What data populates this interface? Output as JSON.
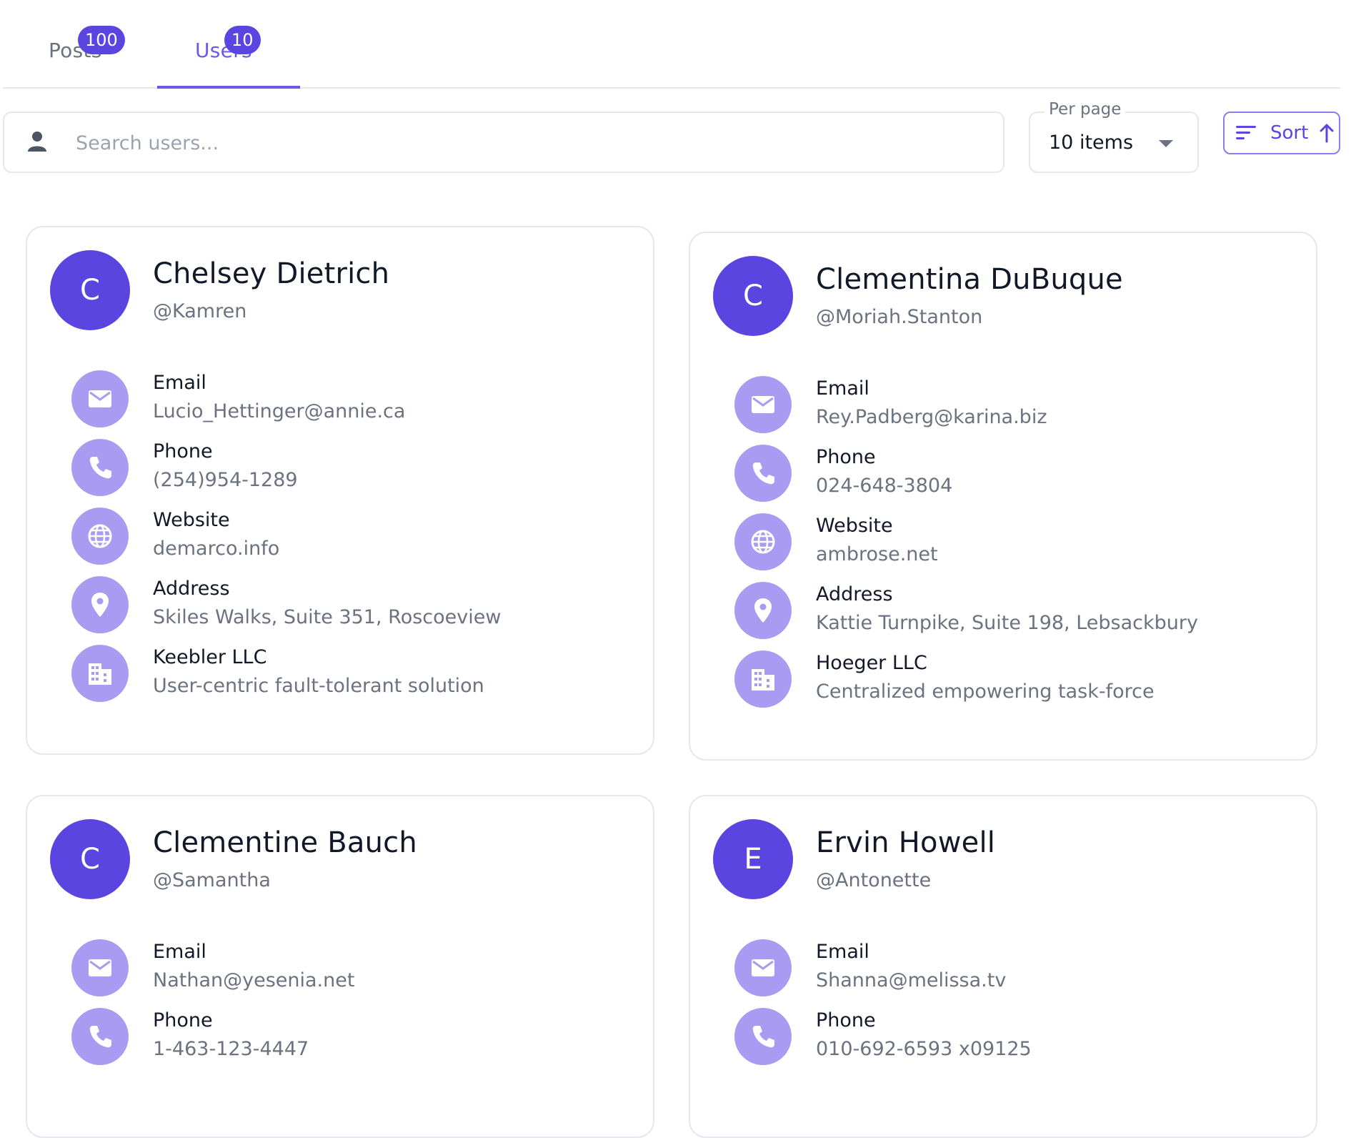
{
  "tabs": [
    {
      "label": "Posts",
      "count": "100"
    },
    {
      "label": "Users",
      "count": "10"
    }
  ],
  "search": {
    "placeholder": "Search users..."
  },
  "per_page": {
    "label": "Per page",
    "value": "10 items"
  },
  "sort": {
    "label": "Sort"
  },
  "colors": {
    "accent": "#6f55e8",
    "avatar": "#5b45e0",
    "icon_bg": "#a99bf2"
  },
  "users": [
    {
      "initial": "C",
      "name": "Chelsey Dietrich",
      "username": "@Kamren",
      "email_label": "Email",
      "email": "Lucio_Hettinger@annie.ca",
      "phone_label": "Phone",
      "phone": "(254)954-1289",
      "website_label": "Website",
      "website": "demarco.info",
      "address_label": "Address",
      "address": "Skiles Walks, Suite 351, Roscoeview",
      "company": "Keebler LLC",
      "catch_phrase": "User-centric fault-tolerant solution"
    },
    {
      "initial": "C",
      "name": "Clementina DuBuque",
      "username": "@Moriah.Stanton",
      "email_label": "Email",
      "email": "Rey.Padberg@karina.biz",
      "phone_label": "Phone",
      "phone": "024-648-3804",
      "website_label": "Website",
      "website": "ambrose.net",
      "address_label": "Address",
      "address": "Kattie Turnpike, Suite 198, Lebsackbury",
      "company": "Hoeger LLC",
      "catch_phrase": "Centralized empowering task-force"
    },
    {
      "initial": "C",
      "name": "Clementine Bauch",
      "username": "@Samantha",
      "email_label": "Email",
      "email": "Nathan@yesenia.net",
      "phone_label": "Phone",
      "phone": "1-463-123-4447"
    },
    {
      "initial": "E",
      "name": "Ervin Howell",
      "username": "@Antonette",
      "email_label": "Email",
      "email": "Shanna@melissa.tv",
      "phone_label": "Phone",
      "phone": "010-692-6593 x09125"
    }
  ]
}
